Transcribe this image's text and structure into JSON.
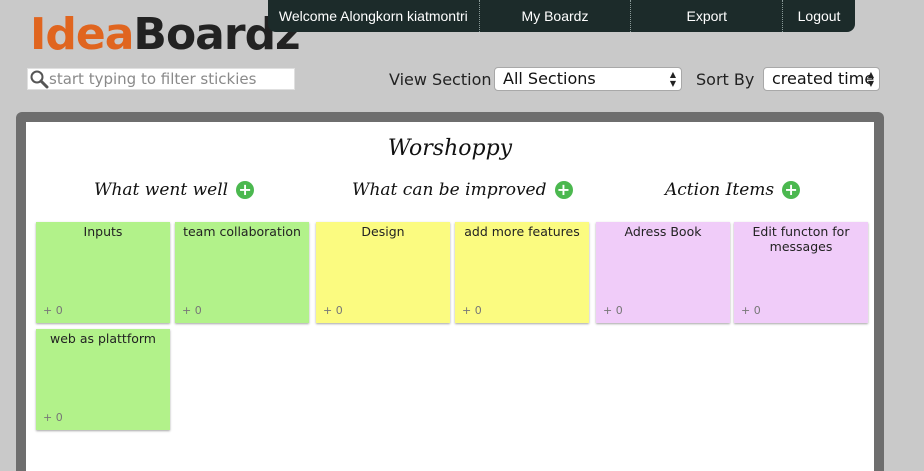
{
  "logo": {
    "part1": "Idea",
    "part2": "Boardz"
  },
  "nav": {
    "welcome": "Welcome Alongkorn kiatmontri",
    "my_boardz": "My Boardz",
    "export": "Export",
    "logout": "Logout"
  },
  "search": {
    "placeholder": "start typing to filter stickies",
    "value": ""
  },
  "controls": {
    "view_section_label": "View Section",
    "view_section_value": "All Sections",
    "sort_by_label": "Sort By",
    "sort_by_value": "created time"
  },
  "board": {
    "title": "Worshoppy",
    "sections": [
      {
        "name": "What went well",
        "color": "#b2f28a",
        "stickies": [
          {
            "text": "Inputs",
            "votes": "+ 0"
          },
          {
            "text": "team collaboration",
            "votes": "+ 0"
          },
          {
            "text": "web as plattform",
            "votes": "+ 0"
          }
        ]
      },
      {
        "name": "What can be improved",
        "color": "#fbfb80",
        "stickies": [
          {
            "text": "Design",
            "votes": "+ 0"
          },
          {
            "text": "add more features",
            "votes": "+ 0"
          }
        ]
      },
      {
        "name": "Action Items",
        "color": "#f0ccf9",
        "stickies": [
          {
            "text": "Adress Book",
            "votes": "+ 0"
          },
          {
            "text": "Edit functon for messages",
            "votes": "+ 0"
          }
        ]
      }
    ]
  },
  "icons": {
    "search": "magnifier-icon",
    "add": "plus-circle-icon",
    "select_arrows": "up-down-arrows-icon"
  },
  "colors": {
    "accent_orange": "#e0651f",
    "nav_bg": "#1c2b2a",
    "add_green": "#4bb84f"
  }
}
